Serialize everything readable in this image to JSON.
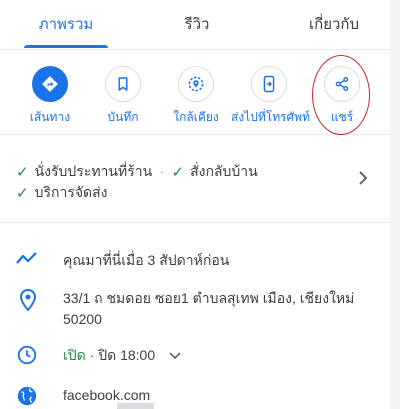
{
  "tabs": [
    {
      "label": "ภาพรวม",
      "active": true
    },
    {
      "label": "รีวิว",
      "active": false
    },
    {
      "label": "เกี่ยวกับ",
      "active": false
    }
  ],
  "actions": [
    {
      "label": "เส้นทาง",
      "icon": "directions-icon"
    },
    {
      "label": "บันทึก",
      "icon": "bookmark-icon"
    },
    {
      "label": "ใกล้เคียง",
      "icon": "nearby-icon"
    },
    {
      "label": "ส่งไปที่โทรศัพท์",
      "icon": "send-to-phone-icon"
    },
    {
      "label": "แชร์",
      "icon": "share-icon"
    }
  ],
  "services": {
    "dine_in": "นั่งรับประทานที่ร้าน",
    "takeout": "สั่งกลับบ้าน",
    "delivery": "บริการจัดส่ง",
    "separator": "·"
  },
  "info": {
    "visit_note": "คุณมาที่นี่เมื่อ 3 สัปดาห์ก่อน",
    "address_line1": "33/1 ถ ชมดอย ซอย1 ตำบลสุเทพ เมือง, เชียงใหม่",
    "address_line2": "50200",
    "hours_status": "เปิด",
    "hours_rest": " · ปิด 18:00",
    "website": "facebook.com"
  },
  "colors": {
    "accent": "#1a73e8",
    "open_green": "#1e8e3e",
    "annotation_red": "#c62828"
  }
}
